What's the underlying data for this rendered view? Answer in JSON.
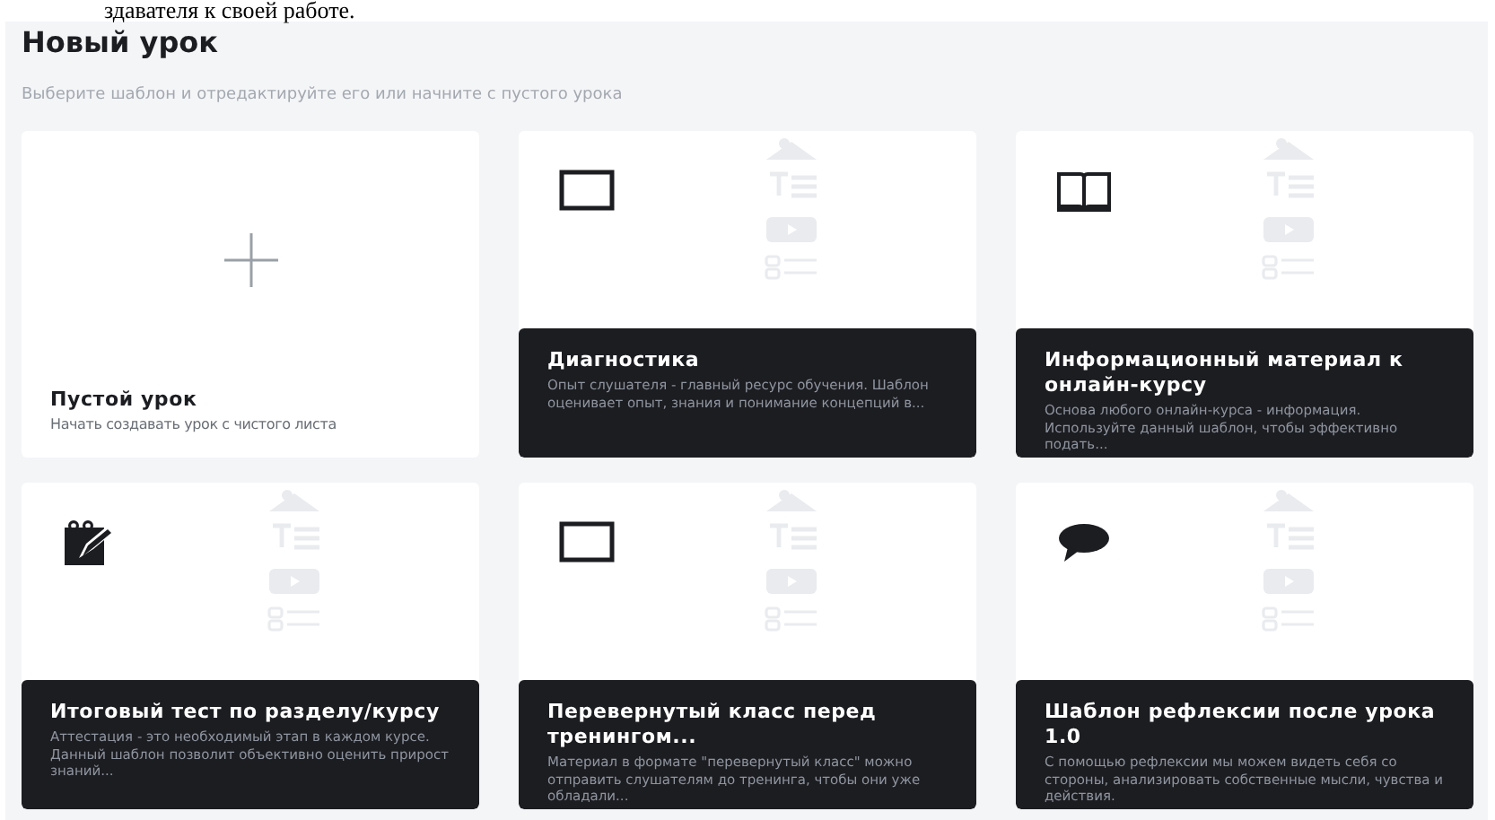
{
  "document_text": "здавателя к своей работе.",
  "page": {
    "title": "Новый урок",
    "subtitle": "Выберите шаблон и отредактируйте его или начните с пустого урока"
  },
  "cards": [
    {
      "kind": "blank",
      "title": "Пустой урок",
      "description": "Начать создавать урок с чистого листа"
    },
    {
      "kind": "template",
      "title": "Диагностика",
      "description": "Опыт слушателя - главный ресурс обучения. Шаблон оценивает опыт, знания и понимание концепций в..."
    },
    {
      "kind": "template",
      "title": "Информационный материал к онлайн-курсу",
      "description": "Основа любого онлайн-курса - информация. Используйте данный шаблон, чтобы эффективно подать..."
    },
    {
      "kind": "template",
      "title": "Итоговый тест по разделу/курсу",
      "description": "Аттестация - это необходимый этап в каждом курсе. Данный шаблон позволит объективно оценить прирост знаний..."
    },
    {
      "kind": "template",
      "title": "Перевернутый класс перед тренингом...",
      "description": "Материал в формате \"перевернутый класс\" можно отправить слушателям до тренинга, чтобы они уже обладали..."
    },
    {
      "kind": "template",
      "title": "Шаблон рефлексии после урока 1.0",
      "description": "С помощью рефлексии мы можем видеть себя со стороны, анализировать собственные мысли, чувства и действия."
    }
  ]
}
